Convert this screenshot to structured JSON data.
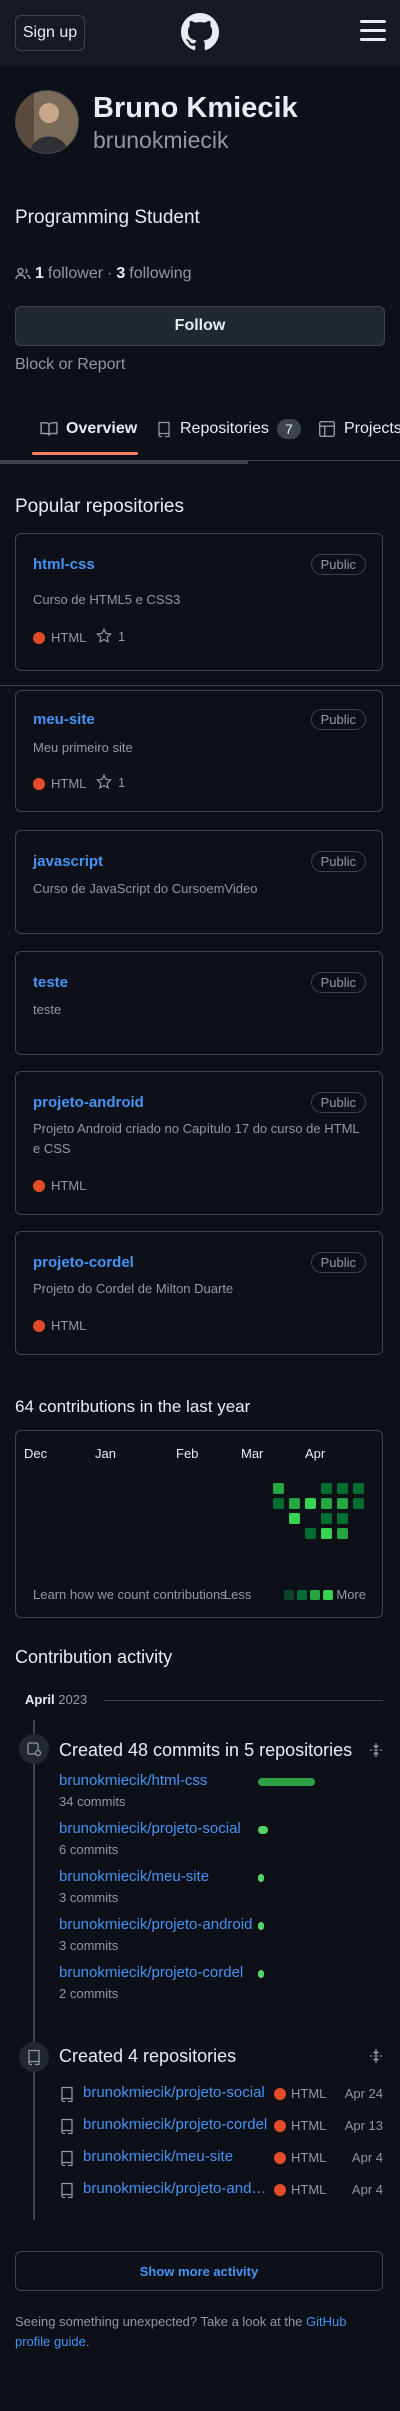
{
  "header": {
    "signup_label": "Sign up",
    "logo_icon": "github-octocat-icon",
    "menu_icon": "hamburger-menu-icon"
  },
  "profile": {
    "name": "Bruno Kmiecik",
    "login": "brunokmiecik",
    "bio": "Programming Student",
    "followers_count": "1",
    "followers_label": "follower",
    "separator": "·",
    "following_count": "3",
    "following_label": "following",
    "follow_label": "Follow",
    "block_label": "Block or Report"
  },
  "tabs": [
    {
      "label": "Overview",
      "icon": "book-icon",
      "active": true
    },
    {
      "label": "Repositories",
      "icon": "repo-icon",
      "count": "7"
    },
    {
      "label": "Projects",
      "icon": "table-icon"
    }
  ],
  "popular": {
    "title": "Popular repositories",
    "repos": [
      {
        "name": "html-css",
        "visibility": "Public",
        "desc": "Curso de HTML5 e CSS3",
        "lang": "HTML",
        "stars": "1"
      },
      {
        "name": "meu-site",
        "visibility": "Public",
        "desc": "Meu primeiro site",
        "lang": "HTML",
        "stars": "1"
      },
      {
        "name": "javascript",
        "visibility": "Public",
        "desc": "Curso de JavaScript do CursoemVideo"
      },
      {
        "name": "teste",
        "visibility": "Public",
        "desc": "teste"
      },
      {
        "name": "projeto-android",
        "visibility": "Public",
        "desc": "Projeto Android criado no Capítulo 17 do curso de HTML e CSS",
        "lang": "HTML"
      },
      {
        "name": "projeto-cordel",
        "visibility": "Public",
        "desc": "Projeto do Cordel de Milton Duarte",
        "lang": "HTML"
      }
    ]
  },
  "contributions": {
    "title": "64 contributions in the last year",
    "months": [
      "Dec",
      "Jan",
      "Feb",
      "Mar",
      "Apr"
    ],
    "learn_label": "Learn how we count contributions",
    "less_label": "Less",
    "more_label": "More",
    "colors": {
      "l1": "#0e4429",
      "l2": "#006d32",
      "l3": "#26a641",
      "l4": "#39d353"
    }
  },
  "activity": {
    "title": "Contribution activity",
    "month": "April",
    "year": "2023",
    "commits": {
      "title": "Created 48 commits in 5 repositories",
      "items": [
        {
          "repo": "brunokmiecik/html-css",
          "count": "34 commits",
          "share": 0.71
        },
        {
          "repo": "brunokmiecik/projeto-social",
          "count": "6 commits",
          "share": 0.13
        },
        {
          "repo": "brunokmiecik/meu-site",
          "count": "3 commits",
          "share": 0.06
        },
        {
          "repo": "brunokmiecik/projeto-android",
          "count": "3 commits",
          "share": 0.06
        },
        {
          "repo": "brunokmiecik/projeto-cordel",
          "count": "2 commits",
          "share": 0.04
        }
      ]
    },
    "created": {
      "title": "Created 4 repositories",
      "items": [
        {
          "repo": "brunokmiecik/projeto-social",
          "lang": "HTML",
          "date": "Apr 24"
        },
        {
          "repo": "brunokmiecik/projeto-cordel",
          "lang": "HTML",
          "date": "Apr 13"
        },
        {
          "repo": "brunokmiecik/meu-site",
          "lang": "HTML",
          "date": "Apr 4"
        },
        {
          "repo": "brunokmiecik/projeto-android",
          "lang": "HTML",
          "date": "Apr 4"
        }
      ]
    },
    "more_label": "Show more activity"
  },
  "footer": {
    "text": "Seeing something unexpected? Take a look at the",
    "link": "GitHub profile guide",
    "end": "."
  }
}
